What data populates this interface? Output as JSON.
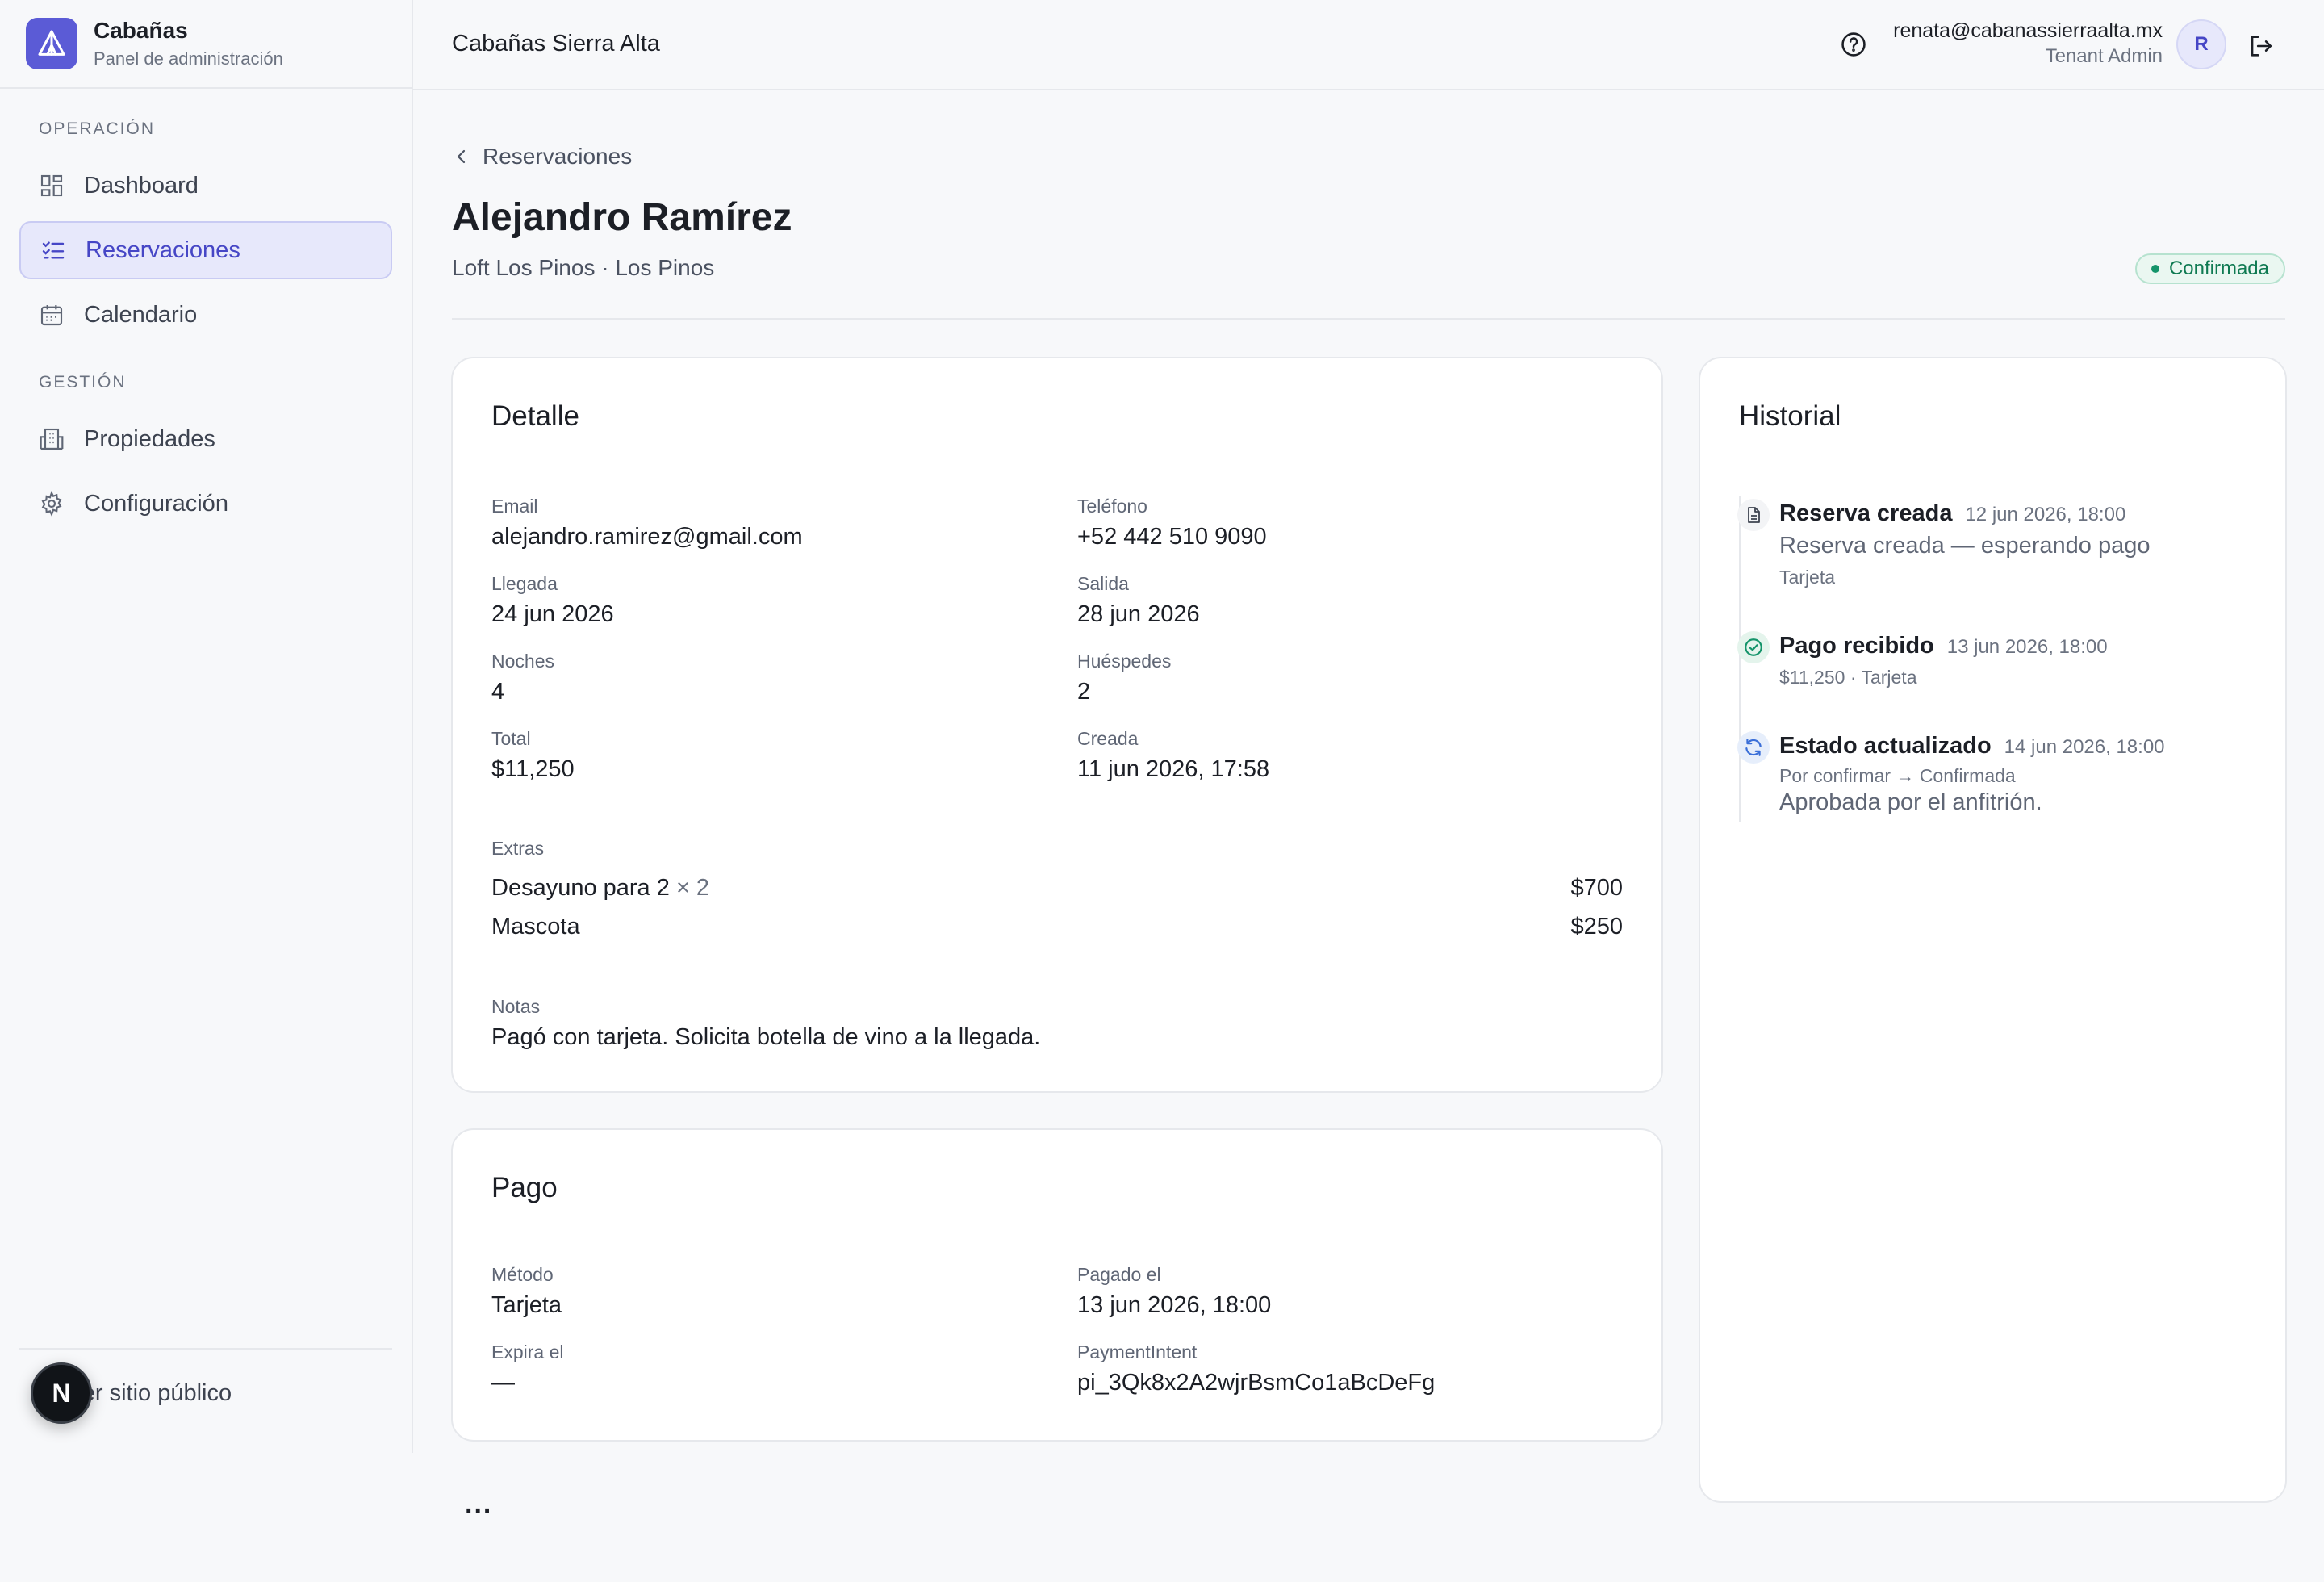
{
  "brand": {
    "name": "Cabañas",
    "subtitle": "Panel de administración"
  },
  "sidebar": {
    "sections": [
      {
        "label": "Operación",
        "items": [
          {
            "label": "Dashboard",
            "icon": "dashboard-icon"
          },
          {
            "label": "Reservaciones",
            "icon": "checklist-icon",
            "active": true
          },
          {
            "label": "Calendario",
            "icon": "calendar-icon"
          }
        ]
      },
      {
        "label": "Gestión",
        "items": [
          {
            "label": "Propiedades",
            "icon": "building-icon"
          },
          {
            "label": "Configuración",
            "icon": "gear-icon"
          }
        ]
      }
    ],
    "public_link": "Ver sitio público",
    "next_badge": "N"
  },
  "topbar": {
    "title": "Cabañas Sierra Alta",
    "user_email": "renata@cabanassierraalta.mx",
    "user_role": "Tenant Admin",
    "avatar_initial": "R"
  },
  "breadcrumb": "Reservaciones",
  "reservation": {
    "guest_name": "Alejandro Ramírez",
    "property_line": "Loft Los Pinos · Los Pinos",
    "status": "Confirmada"
  },
  "detail": {
    "title": "Detalle",
    "fields": {
      "email": {
        "label": "Email",
        "value": "alejandro.ramirez@gmail.com"
      },
      "phone": {
        "label": "Teléfono",
        "value": "+52 442 510 9090"
      },
      "arrival": {
        "label": "Llegada",
        "value": "24 jun 2026"
      },
      "departure": {
        "label": "Salida",
        "value": "28 jun 2026"
      },
      "nights": {
        "label": "Noches",
        "value": "4"
      },
      "guests": {
        "label": "Huéspedes",
        "value": "2"
      },
      "total": {
        "label": "Total",
        "value": "$11,250"
      },
      "created": {
        "label": "Creada",
        "value": "11 jun 2026, 17:58"
      }
    },
    "extras_label": "Extras",
    "extras": [
      {
        "name": "Desayuno para 2",
        "qty": "× 2",
        "amount": "$700"
      },
      {
        "name": "Mascota",
        "qty": "",
        "amount": "$250"
      }
    ],
    "notes_label": "Notas",
    "notes": "Pagó con tarjeta. Solicita botella de vino a la llegada."
  },
  "payment": {
    "title": "Pago",
    "fields": {
      "method": {
        "label": "Método",
        "value": "Tarjeta"
      },
      "paid_at": {
        "label": "Pagado el",
        "value": "13 jun 2026, 18:00"
      },
      "expires": {
        "label": "Expira el",
        "value": "—"
      },
      "intent": {
        "label": "PaymentIntent",
        "value": "pi_3Qk8x2A2wjrBsmCo1aBcDeFg"
      }
    }
  },
  "history": {
    "title": "Historial",
    "events": [
      {
        "title": "Reserva creada",
        "date": "12 jun 2026, 18:00",
        "description": "Reserva creada — esperando pago",
        "meta": "Tarjeta",
        "icon": "document-icon"
      },
      {
        "title": "Pago recibido",
        "date": "13 jun 2026, 18:00",
        "meta": "$11,250 · Tarjeta",
        "icon": "check-circle-icon"
      },
      {
        "title": "Estado actualizado",
        "date": "14 jun 2026, 18:00",
        "meta": "Por confirmar → Confirmada",
        "description": "Aprobada por el anfitrión.",
        "icon": "refresh-icon"
      }
    ]
  },
  "more_indicator": "...",
  "colors": {
    "accent": "#5b5bd6",
    "status_green": "#0f7a52"
  }
}
